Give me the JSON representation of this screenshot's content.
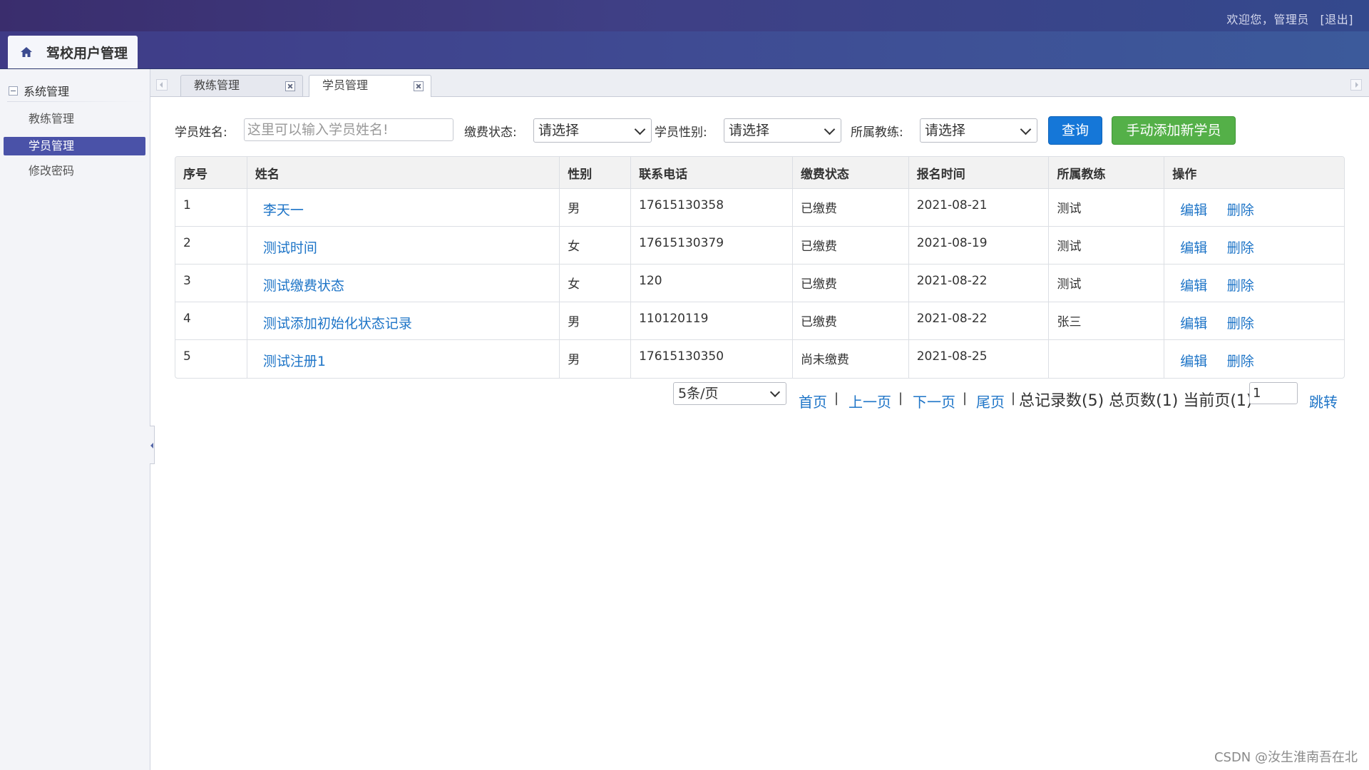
{
  "header": {
    "welcome_text": "欢迎您，管理员",
    "logout_label": "[退出]",
    "app_title": "驾校用户管理",
    "home_icon": "home-icon"
  },
  "sidebar": {
    "group_label": "系统管理",
    "items": [
      {
        "label": "教练管理",
        "active": false
      },
      {
        "label": "学员管理",
        "active": true
      },
      {
        "label": "修改密码",
        "active": false
      }
    ]
  },
  "tabs": [
    {
      "label": "教练管理",
      "active": false
    },
    {
      "label": "学员管理",
      "active": true
    }
  ],
  "search": {
    "name_label": "学员姓名:",
    "name_placeholder": "这里可以输入学员姓名!",
    "fee_label": "缴费状态:",
    "fee_value": "请选择",
    "gender_label": "学员性别:",
    "gender_value": "请选择",
    "coach_label": "所属教练:",
    "coach_value": "请选择",
    "query_label": "查询",
    "add_label": "手动添加新学员"
  },
  "table": {
    "columns": [
      "序号",
      "姓名",
      "性别",
      "联系电话",
      "缴费状态",
      "报名时间",
      "所属教练",
      "操作"
    ],
    "rows": [
      {
        "no": "1",
        "name": "李天一",
        "gender": "男",
        "phone": "17615130358",
        "fee": "已缴费",
        "date": "2021-08-21",
        "coach": "测试"
      },
      {
        "no": "2",
        "name": "测试时间",
        "gender": "女",
        "phone": "17615130379",
        "fee": "已缴费",
        "date": "2021-08-19",
        "coach": "测试"
      },
      {
        "no": "3",
        "name": "测试缴费状态",
        "gender": "女",
        "phone": "120",
        "fee": "已缴费",
        "date": "2021-08-22",
        "coach": "测试"
      },
      {
        "no": "4",
        "name": "测试添加初始化状态记录",
        "gender": "男",
        "phone": "110120119",
        "fee": "已缴费",
        "date": "2021-08-22",
        "coach": "张三"
      },
      {
        "no": "5",
        "name": "测试注册1",
        "gender": "男",
        "phone": "17615130350",
        "fee": "尚未缴费",
        "date": "2021-08-25",
        "coach": ""
      }
    ],
    "edit_label": "编辑",
    "delete_label": "删除"
  },
  "pager": {
    "page_size": "5条/页",
    "first": "首页",
    "prev": "上一页",
    "next": "下一页",
    "last": "尾页",
    "separator": "|",
    "info": "总记录数(5) 总页数(1) 当前页(1)",
    "page_input": "1",
    "jump": "跳转"
  },
  "watermark": "CSDN @汝生淮南吾在北",
  "colors": {
    "accent": "#4a52a8",
    "link": "#1d74c7",
    "query_button": "#1577d8",
    "add_button": "#54b048"
  }
}
